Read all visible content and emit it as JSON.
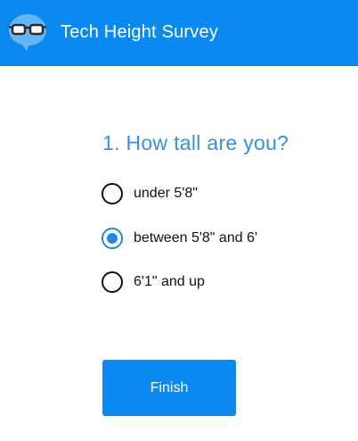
{
  "header": {
    "title": "Tech Height Survey",
    "logo_icon": "glasses-chat-bubble-icon",
    "background": "#0a89f0"
  },
  "question": {
    "text": "1. How tall are you?",
    "options": [
      {
        "label": "under 5'8\"",
        "selected": false
      },
      {
        "label": "between 5'8\" and 6'",
        "selected": true
      },
      {
        "label": "6'1\" and up",
        "selected": false
      }
    ]
  },
  "actions": {
    "finish_label": "Finish"
  }
}
